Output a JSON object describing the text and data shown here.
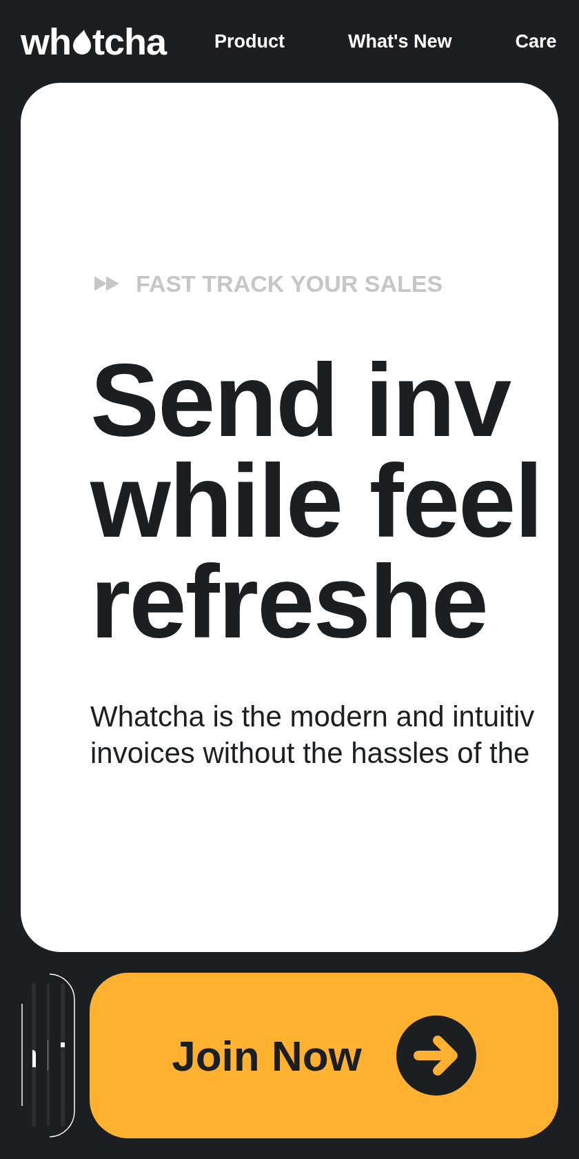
{
  "header": {
    "logo": {
      "text_before": "wh",
      "text_after": "tcha"
    },
    "nav": [
      "Product",
      "What's New",
      "Care"
    ]
  },
  "hero": {
    "eyebrow": "FAST TRACK YOUR SALES",
    "headline_lines": [
      "Send inv",
      "while feel",
      "refreshe"
    ],
    "intro_lines": [
      "Whatcha is the modern and intuitiv",
      "invoices without the hassles of the"
    ]
  },
  "cta": {
    "label": "Join Now"
  }
}
